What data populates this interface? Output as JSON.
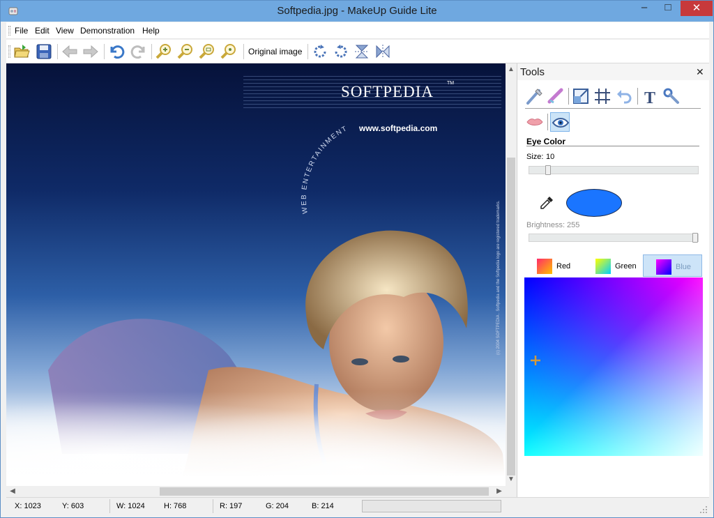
{
  "window": {
    "title": "Softpedia.jpg - MakeUp Guide Lite",
    "minimize_glyph": "–",
    "maximize_glyph": "□",
    "close_glyph": "✕"
  },
  "menu": {
    "items": [
      "File",
      "Edit",
      "View",
      "Demonstration",
      "Help"
    ]
  },
  "toolbar": {
    "original_image_label": "Original image",
    "icons": [
      "open-folder-icon",
      "save-icon",
      "back-arrow-icon",
      "forward-arrow-icon",
      "undo-icon",
      "redo-icon",
      "zoom-in-icon",
      "zoom-out-icon",
      "zoom-fit-icon",
      "zoom-actual-icon",
      "rotate-cw-icon",
      "rotate-ccw-icon",
      "flip-vertical-icon",
      "flip-horizontal-icon"
    ]
  },
  "image": {
    "logo_text": "SOFTPEDIA",
    "logo_tm": "TM",
    "url_text": "www.softpedia.com",
    "arc_text": "WEB ENTERTAINMENT",
    "side_text": "(c) 2004 SOFTPEDIA . Softpedia and the Softpedia logo are registered trademarks."
  },
  "tools": {
    "title": "Tools",
    "close_glyph": "✕",
    "section_title": "Eye Color",
    "size_label": "Size:",
    "size_value": "10",
    "size_fraction": 0.1,
    "brightness_label": "Brightness:",
    "brightness_value": "255",
    "brightness_fraction": 1.0,
    "current_color": "#1a75ff",
    "tabs": [
      {
        "label": "Red",
        "active": false
      },
      {
        "label": "Green",
        "active": false
      },
      {
        "label": "Blue",
        "active": true
      }
    ],
    "icons_row1": [
      "brush-icon",
      "eraser-icon",
      "crop-icon",
      "grid-icon",
      "undo-arrow-icon",
      "text-icon",
      "wrench-icon"
    ],
    "icons_row2": [
      "lips-icon",
      "eye-icon"
    ]
  },
  "status": {
    "x": "X: 1023",
    "y": "Y: 603",
    "w": "W: 1024",
    "h": "H: 768",
    "r": "R: 197",
    "g": "G: 204",
    "b": "B: 214"
  }
}
